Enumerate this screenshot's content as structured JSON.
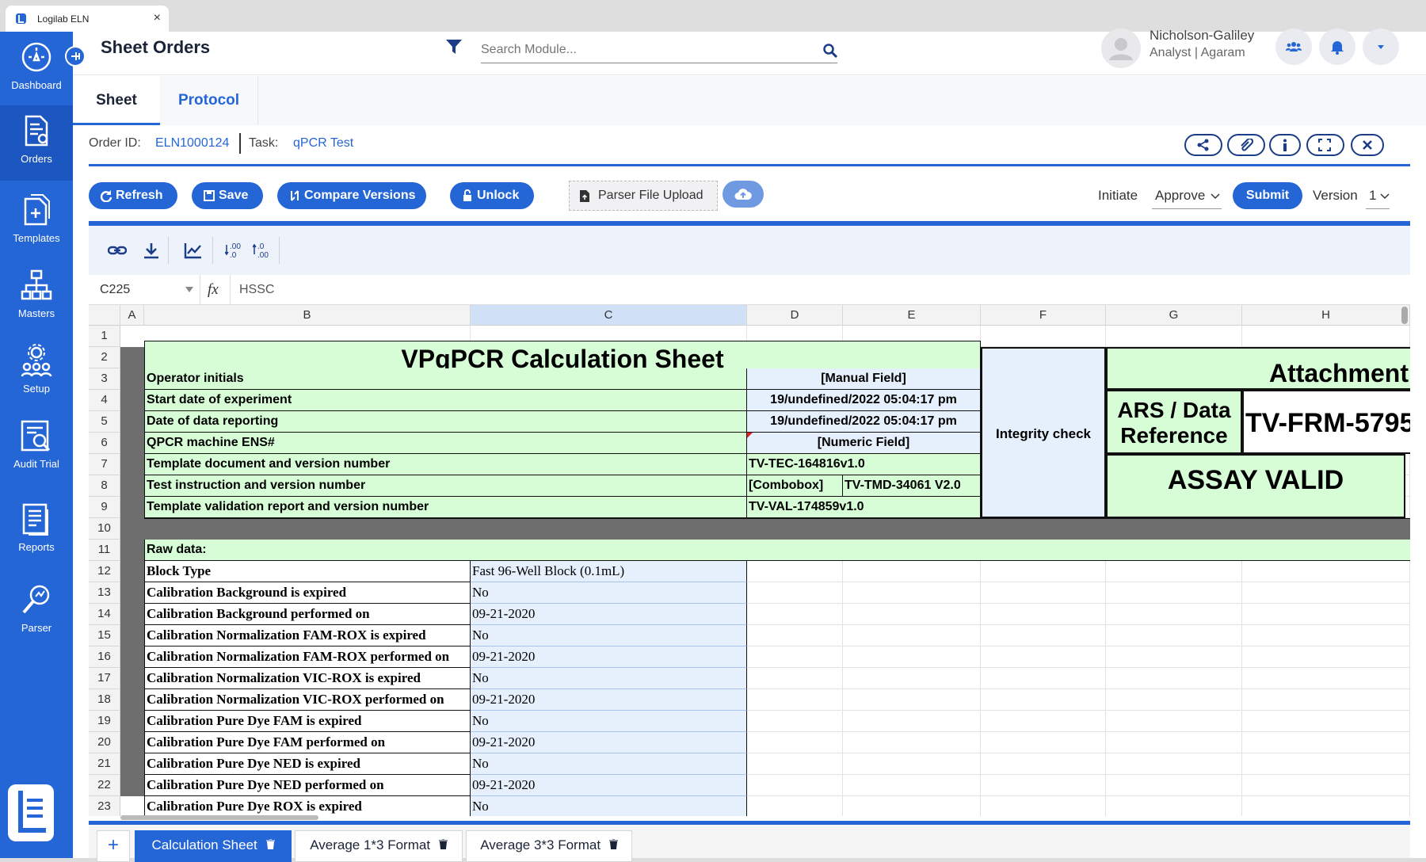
{
  "browser": {
    "tab_title": "Logilab ELN",
    "close": "×"
  },
  "sidebar": {
    "items": [
      {
        "label": "Dashboard"
      },
      {
        "label": "Orders"
      },
      {
        "label": "Templates"
      },
      {
        "label": "Masters"
      },
      {
        "label": "Setup"
      },
      {
        "label": "Audit Trial"
      },
      {
        "label": "Reports"
      },
      {
        "label": "Parser"
      }
    ]
  },
  "header": {
    "title": "Sheet Orders",
    "search_placeholder": "Search Module...",
    "user_name": "Nicholson-Galiley",
    "user_role": "Analyst | Agaram"
  },
  "subtabs": {
    "sheet": "Sheet",
    "protocol": "Protocol"
  },
  "info": {
    "order_label": "Order ID:",
    "order_id": "ELN1000124",
    "task_label": "Task:",
    "task": "qPCR Test"
  },
  "actions": {
    "refresh": "Refresh",
    "save": "Save",
    "compare": "Compare Versions",
    "unlock": "Unlock",
    "parser_upload": "Parser File Upload",
    "initiate": "Initiate",
    "initiate_value": "Approve",
    "submit": "Submit",
    "version_label": "Version",
    "version_value": "1"
  },
  "formula_bar": {
    "cell_ref": "C225",
    "fx": "fx",
    "value": "HSSC"
  },
  "sheet": {
    "columns": [
      "A",
      "B",
      "C",
      "D",
      "E",
      "F",
      "G",
      "H"
    ],
    "rows": [
      "1",
      "2",
      "3",
      "4",
      "5",
      "6",
      "7",
      "8",
      "9",
      "10",
      "11",
      "12",
      "13",
      "14",
      "15",
      "16",
      "17",
      "18",
      "19",
      "20",
      "21",
      "22",
      "23"
    ],
    "title": "VPqPCR Calculation Sheet",
    "attachment": "Attachment",
    "integrity": "Integrity check",
    "ars_ref": "ARS / Data Reference",
    "frm": "TV-FRM-5795",
    "assay": "ASSAY VALID",
    "header_rows": [
      {
        "label": "Operator initials",
        "value": "[Manual Field]"
      },
      {
        "label": "Start date of experiment",
        "value": "19/undefined/2022 05:04:17 pm"
      },
      {
        "label": "Date of data reporting",
        "value": "19/undefined/2022 05:04:17 pm"
      },
      {
        "label": "QPCR machine ENS#",
        "value": "[Numeric Field]"
      },
      {
        "label": "Template document and version number",
        "value": "TV-TEC-164816v1.0"
      },
      {
        "label": "Test instruction and version number",
        "value": "[Combobox]",
        "value2": "TV-TMD-34061 V2.0"
      },
      {
        "label": "Template validation report and version number",
        "value": "TV-VAL-174859v1.0"
      }
    ],
    "raw_label": "Raw data:",
    "raw_rows": [
      {
        "label": "Block Type",
        "value": "Fast 96-Well Block (0.1mL)"
      },
      {
        "label": "Calibration Background is expired",
        "value": "No"
      },
      {
        "label": "Calibration Background performed on",
        "value": "09-21-2020"
      },
      {
        "label": "Calibration Normalization FAM-ROX is expired",
        "value": "No"
      },
      {
        "label": "Calibration Normalization FAM-ROX performed on",
        "value": "09-21-2020"
      },
      {
        "label": "Calibration Normalization VIC-ROX is expired",
        "value": "No"
      },
      {
        "label": "Calibration Normalization VIC-ROX performed on",
        "value": "09-21-2020"
      },
      {
        "label": "Calibration Pure Dye FAM is expired",
        "value": "No"
      },
      {
        "label": "Calibration Pure Dye FAM performed on",
        "value": "09-21-2020"
      },
      {
        "label": "Calibration Pure Dye NED is expired",
        "value": "No"
      },
      {
        "label": "Calibration Pure Dye NED performed on",
        "value": "09-21-2020"
      },
      {
        "label": "Calibration Pure Dye ROX is expired",
        "value": "No"
      }
    ]
  },
  "bottom_tabs": {
    "add": "+",
    "tabs": [
      "Calculation Sheet",
      "Average 1*3 Format",
      "Average 3*3 Format"
    ]
  },
  "colors": {
    "primary": "#2566d6",
    "sheet_green": "#d6fdd6",
    "sheet_blue": "#e6f0fc",
    "dark_band": "#6e6e6e"
  }
}
